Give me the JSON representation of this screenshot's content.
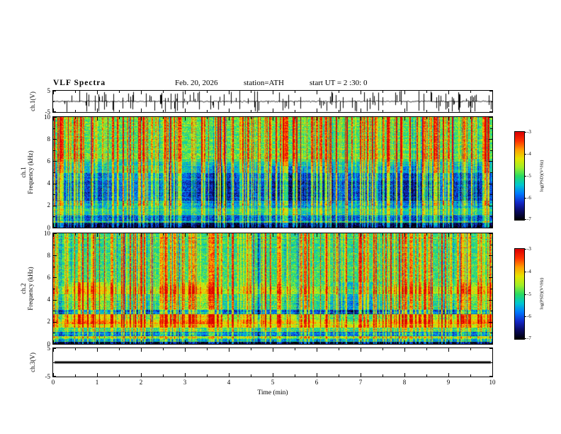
{
  "header": {
    "title": "VLF  Spectra",
    "date": "Feb. 20, 2026",
    "station": "station=ATH",
    "start_ut": "start UT =  2 :30: 0"
  },
  "axes": {
    "x": {
      "label": "Time (min)",
      "min": 0,
      "max": 10,
      "major_ticks": [
        0,
        1,
        2,
        3,
        4,
        5,
        6,
        7,
        8,
        9,
        10
      ]
    },
    "freq": {
      "min": 0,
      "max": 10,
      "major_ticks": [
        0,
        2,
        4,
        6,
        8,
        10
      ],
      "minor_ticks": [
        1,
        3,
        5,
        7,
        9
      ]
    },
    "volt": {
      "min": -5,
      "max": 5,
      "major_ticks": [
        5,
        -5
      ]
    }
  },
  "colorbar": {
    "label": "log(PSD)(V²/Hz)",
    "ticks": [
      -3,
      -4,
      -5,
      -6,
      -7
    ],
    "min": -7,
    "max": -3,
    "colors": [
      "#000000",
      "#0a0a5f",
      "#1428c8",
      "#0078ff",
      "#00c8d2",
      "#28dc64",
      "#a0f028",
      "#e6e600",
      "#ffa000",
      "#ff3200",
      "#dc0000"
    ]
  },
  "chart_data": [
    {
      "type": "line",
      "name": "ch1-voltage-waveform",
      "ylabel": "ch.1(V)",
      "ylim": [
        -5,
        5
      ],
      "yticks": [
        5,
        -5
      ],
      "xlim": [
        0,
        10
      ],
      "description": "broadband noise near 0 V with many impulsive spikes reaching ±5 V",
      "noise_amp_v": 0.4,
      "spike_count": 130,
      "spike_max_v": 5
    },
    {
      "type": "heatmap",
      "name": "ch1-spectrogram",
      "ylabel_line1": "ch.1",
      "ylabel_line2": "Frequency (kHz)",
      "ylim": [
        0,
        10
      ],
      "xlim": [
        0,
        10
      ],
      "zlim": [
        -7,
        -3
      ],
      "zlabel": "log(PSD)(V²/Hz)",
      "bands": [
        {
          "f_lo": 6.0,
          "f_hi": 10.0,
          "psd": -4.85
        },
        {
          "f_lo": 5.0,
          "f_hi": 6.0,
          "psd": -5.4
        },
        {
          "f_lo": 4.3,
          "f_hi": 5.0,
          "psd": -5.9
        },
        {
          "f_lo": 2.5,
          "f_hi": 4.3,
          "psd": -6.05
        },
        {
          "f_lo": 1.8,
          "f_hi": 2.5,
          "psd": -5.55
        },
        {
          "f_lo": 1.2,
          "f_hi": 1.8,
          "psd": -5.2
        },
        {
          "f_lo": 0.6,
          "f_hi": 1.2,
          "psd": -6.0
        },
        {
          "f_lo": 0.45,
          "f_hi": 0.6,
          "psd": -5.3
        },
        {
          "f_lo": 0.25,
          "f_hi": 0.45,
          "psd": -6.7
        },
        {
          "f_lo": 0.0,
          "f_hi": 0.25,
          "psd": -6.95
        }
      ],
      "impulses": {
        "count": 260,
        "min_boost": 0.5,
        "max_boost": 2.1
      },
      "description": "green background above 6 kHz, blue 2.5-5 kHz, dark bands below 1 kHz, dense vertical sferic streaks"
    },
    {
      "type": "heatmap",
      "name": "ch2-spectrogram",
      "ylabel_line1": "ch.2",
      "ylabel_line2": "Frequency (kHz)",
      "ylim": [
        0,
        10
      ],
      "xlim": [
        0,
        10
      ],
      "zlim": [
        -7,
        -3
      ],
      "zlabel": "log(PSD)(V²/Hz)",
      "bands": [
        {
          "f_lo": 5.2,
          "f_hi": 10.0,
          "psd": -5.0
        },
        {
          "f_lo": 4.5,
          "f_hi": 5.2,
          "psd": -4.55
        },
        {
          "f_lo": 3.1,
          "f_hi": 4.5,
          "psd": -5.15
        },
        {
          "f_lo": 2.75,
          "f_hi": 3.1,
          "psd": -6.0
        },
        {
          "f_lo": 2.3,
          "f_hi": 2.75,
          "psd": -4.7
        },
        {
          "f_lo": 1.5,
          "f_hi": 2.3,
          "psd": -4.25
        },
        {
          "f_lo": 1.15,
          "f_hi": 1.5,
          "psd": -5.0
        },
        {
          "f_lo": 0.75,
          "f_hi": 1.15,
          "psd": -5.9
        },
        {
          "f_lo": 0.45,
          "f_hi": 0.75,
          "psd": -4.8
        },
        {
          "f_lo": 0.2,
          "f_hi": 0.45,
          "psd": -5.6
        },
        {
          "f_lo": 0.0,
          "f_hi": 0.2,
          "psd": -6.9
        }
      ],
      "impulses": {
        "count": 240,
        "min_boost": 0.5,
        "max_boost": 1.9
      },
      "description": "mostly green with strong yellow band 1.5-2.3 kHz, yellow line near 4.8 kHz, dark bands near 0.9 and 2.9 kHz, black below 0.2 kHz"
    },
    {
      "type": "line",
      "name": "ch3-voltage-flat",
      "ylabel": "ch.3(V)",
      "ylim": [
        -5,
        5
      ],
      "yticks": [
        5,
        -5
      ],
      "xlim": [
        0,
        10
      ],
      "value_v": 0,
      "description": "thick flat black line at 0 V (dead channel)"
    }
  ]
}
